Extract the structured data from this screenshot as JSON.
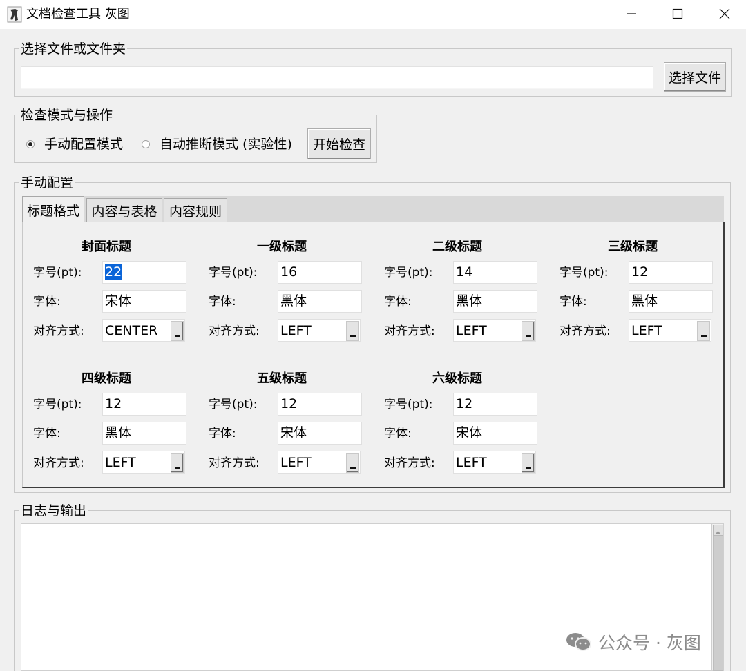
{
  "window": {
    "title": "文档检查工具 灰图",
    "app_icon": "app-figure-icon",
    "controls": [
      "minimize-icon",
      "maximize-icon",
      "close-icon"
    ]
  },
  "file_group": {
    "label": "选择文件或文件夹",
    "path_value": "",
    "browse_button": "选择文件"
  },
  "mode_group": {
    "label": "检查模式与操作",
    "manual_mode": "手动配置模式",
    "auto_mode": "自动推断模式 (实验性)",
    "selected_mode": "manual",
    "start_button": "开始检查"
  },
  "manual_config": {
    "label": "手动配置",
    "tabs": [
      {
        "label": "标题格式",
        "active": true
      },
      {
        "label": "内容与表格",
        "active": false
      },
      {
        "label": "内容规则",
        "active": false
      }
    ],
    "field_labels": {
      "size": "字号(pt):",
      "font": "字体:",
      "align": "对齐方式:"
    },
    "headings": [
      {
        "title": "封面标题",
        "size": "22",
        "font": "宋体",
        "align": "CENTER",
        "size_selected": true
      },
      {
        "title": "一级标题",
        "size": "16",
        "font": "黑体",
        "align": "LEFT"
      },
      {
        "title": "二级标题",
        "size": "14",
        "font": "黑体",
        "align": "LEFT"
      },
      {
        "title": "三级标题",
        "size": "12",
        "font": "黑体",
        "align": "LEFT"
      },
      {
        "title": "四级标题",
        "size": "12",
        "font": "黑体",
        "align": "LEFT"
      },
      {
        "title": "五级标题",
        "size": "12",
        "font": "宋体",
        "align": "LEFT"
      },
      {
        "title": "六级标题",
        "size": "12",
        "font": "宋体",
        "align": "LEFT"
      }
    ]
  },
  "log_group": {
    "label": "日志与输出",
    "content": ""
  },
  "watermark": {
    "text": "公众号 · 灰图",
    "icon": "wechat-icon"
  }
}
